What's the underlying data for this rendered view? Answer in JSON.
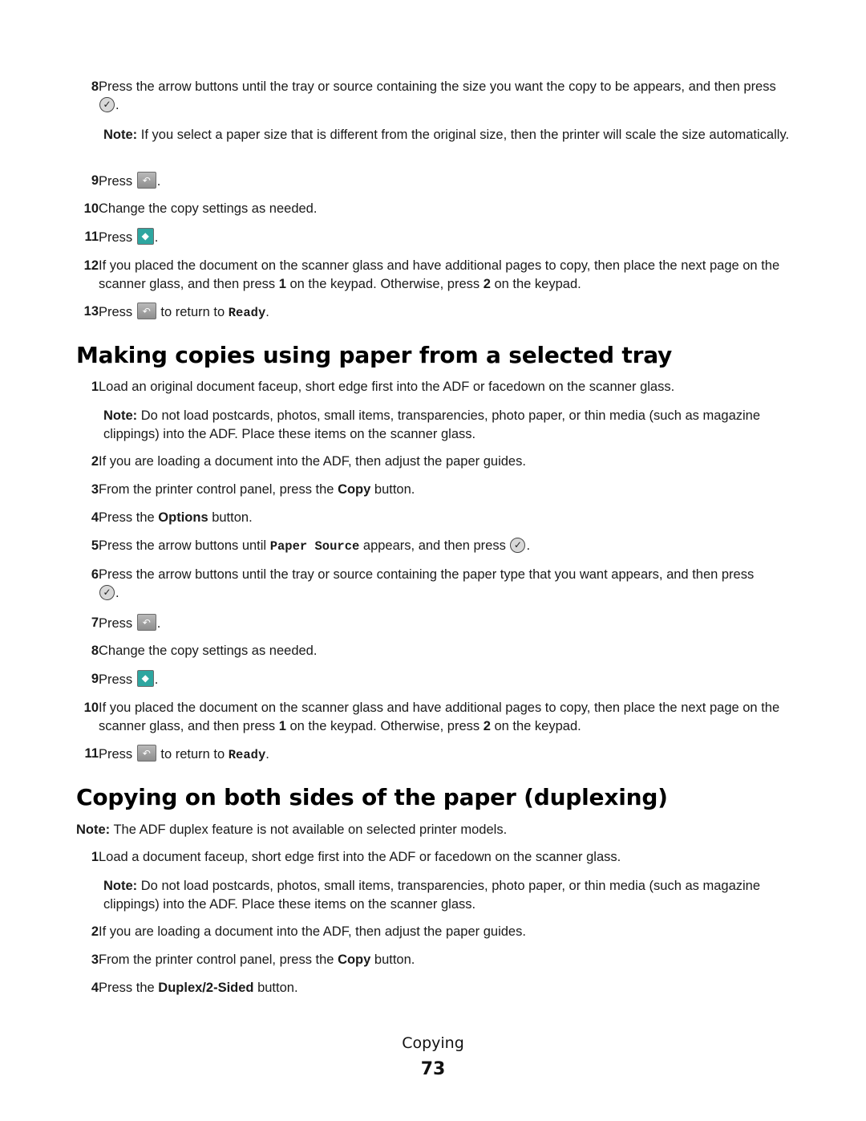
{
  "top_steps": [
    {
      "num": "8",
      "text_before": "Press the arrow buttons until the tray or source containing the size you want the copy to be appears, and then press",
      "icon": "select-check-icon",
      "text_after": "."
    },
    {
      "note_label": "Note:",
      "note_text": "If you select a paper size that is different from the original size, then the printer will scale the size automatically."
    },
    {
      "num": "9",
      "text_before": "Press",
      "icon": "back-button-icon",
      "text_after": "."
    },
    {
      "num": "10",
      "text": "Change the copy settings as needed."
    },
    {
      "num": "11",
      "text_before": "Press",
      "icon": "start-button-icon",
      "text_after": "."
    },
    {
      "num": "12",
      "t1": "If you placed the document on the scanner glass and have additional pages to copy, then place the next page on the scanner glass, and then press ",
      "b1": "1",
      "t2": " on the keypad. Otherwise, press ",
      "b2": "2",
      "t3": " on the keypad."
    },
    {
      "num": "13",
      "text_before": "Press",
      "icon": "back-button-icon",
      "mid": " to return to ",
      "mono": "Ready",
      "text_after": "."
    }
  ],
  "section1": {
    "heading": "Making copies using paper from a selected tray",
    "s1": {
      "num": "1",
      "text": "Load an original document faceup, short edge first into the ADF or facedown on the scanner glass."
    },
    "note": {
      "label": "Note:",
      "text": "Do not load postcards, photos, small items, transparencies, photo paper, or thin media (such as magazine clippings) into the ADF. Place these items on the scanner glass."
    },
    "s2": {
      "num": "2",
      "text": "If you are loading a document into the ADF, then adjust the paper guides."
    },
    "s3": {
      "num": "3",
      "t1": "From the printer control panel, press the ",
      "bold": "Copy",
      "t2": " button."
    },
    "s4": {
      "num": "4",
      "t1": "Press the ",
      "bold": "Options",
      "t2": " button."
    },
    "s5": {
      "num": "5",
      "t1": "Press the arrow buttons until ",
      "mono": "Paper Source",
      "t2": " appears, and then press",
      "t3": "."
    },
    "s6": {
      "num": "6",
      "t1": "Press the arrow buttons until the tray or source containing the paper type that you want appears, and then press",
      "t2": "."
    },
    "s7": {
      "num": "7",
      "t1": "Press",
      "t2": "."
    },
    "s8": {
      "num": "8",
      "text": "Change the copy settings as needed."
    },
    "s9": {
      "num": "9",
      "t1": "Press",
      "t2": "."
    },
    "s10": {
      "num": "10",
      "t1": "If you placed the document on the scanner glass and have additional pages to copy, then place the next page on the scanner glass, and then press ",
      "b1": "1",
      "t2": " on the keypad. Otherwise, press ",
      "b2": "2",
      "t3": " on the keypad."
    },
    "s11": {
      "num": "11",
      "t1": "Press",
      "mid": " to return to ",
      "mono": "Ready",
      "t2": "."
    }
  },
  "section2": {
    "heading": "Copying on both sides of the paper (duplexing)",
    "intro_note": {
      "label": "Note:",
      "text": "The ADF duplex feature is not available on selected printer models."
    },
    "s1": {
      "num": "1",
      "text": "Load a document faceup, short edge first into the ADF or facedown on the scanner glass."
    },
    "note": {
      "label": "Note:",
      "text": "Do not load postcards, photos, small items, transparencies, photo paper, or thin media (such as magazine clippings) into the ADF. Place these items on the scanner glass."
    },
    "s2": {
      "num": "2",
      "text": "If you are loading a document into the ADF, then adjust the paper guides."
    },
    "s3": {
      "num": "3",
      "t1": "From the printer control panel, press the ",
      "bold": "Copy",
      "t2": " button."
    },
    "s4": {
      "num": "4",
      "t1": "Press the ",
      "bold": "Duplex/2-Sided",
      "t2": " button."
    }
  },
  "footer": {
    "chapter": "Copying",
    "page_number": "73"
  }
}
